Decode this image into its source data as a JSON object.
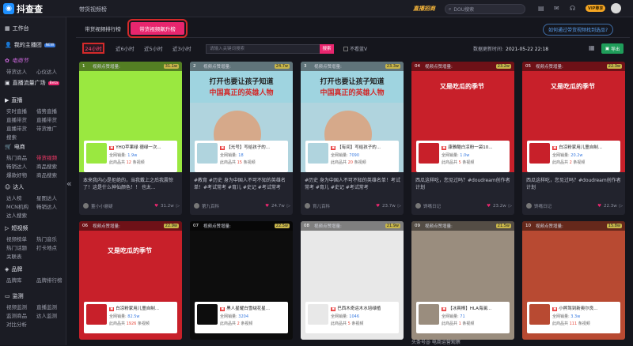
{
  "topbar": {
    "logo_text": "抖查查",
    "page_title": "带货视频榜",
    "promo": "直播招商",
    "search_placeholder": "DOU搜索",
    "vip": "VIP尊享",
    "icons": [
      "printer-icon",
      "mail-icon",
      "headset-icon"
    ]
  },
  "sidebar": {
    "workbench": "工作台",
    "my_host": "我的主播团",
    "my_host_badge": "NEW",
    "festival": "电商节",
    "festival_sub": [
      "带货达人",
      "心仪达人"
    ],
    "traffic": "直播流量广场",
    "traffic_badge": "Beta",
    "live": "直播",
    "live_sub": [
      "实时直播",
      "借势直播",
      "直播带货",
      "直播带货",
      "直播带货",
      "带货推广",
      "搜索"
    ],
    "ecom": "电商",
    "ecom_sub": [
      "热门商品",
      "带货视频",
      "畅销达人",
      "商品搜索",
      "爆款好物",
      "商品搜索"
    ],
    "talent": "达人",
    "talent_sub": [
      "达人榜",
      "星图达人",
      "MCN机构",
      "畅销达人",
      "达人搜索"
    ],
    "short_video": "短视频",
    "short_video_sub": [
      "视频榜单",
      "热门音乐",
      "热门话题",
      "打卡地点",
      "关联表"
    ],
    "brand": "品牌",
    "brand_sub": [
      "品牌库",
      "品牌排行榜"
    ],
    "monitor": "监测",
    "monitor_sub": [
      "视频监测",
      "直播监测",
      "监测商品",
      "达人监测",
      "对比分析"
    ]
  },
  "tabs": {
    "tab1": "带货视频排行榜",
    "tab2": "带货视频飙升榜",
    "help": "如何通过带货视频找到选品?"
  },
  "filters": {
    "ranges": [
      "24小时",
      "近6小时",
      "近5小时",
      "近3小时"
    ],
    "keyword_placeholder": "请输入关键词搜索",
    "search_btn": "搜索",
    "exclude_v": "不看蓝V",
    "update_label": "数据更新时间:",
    "update_time": "2021-05-22 22:18",
    "refresh": "数据更新",
    "export": "导出"
  },
  "card_header_label": "视频点赞增量:",
  "prod_sales_label": "全网销量:",
  "prod_fav_label": "此商品共",
  "prod_fav_suffix": "条视频",
  "cards": [
    {
      "rank": "1",
      "inc": "31.1w",
      "title": "YHQ苹果绿 德绿一次...",
      "sales": "1.9w",
      "fav": "12",
      "desc": "本来我内心是拒绝的，当我戴上之后我震惊了！这是什么神仙颜色！！ 也太...",
      "author": "董小小悬疑",
      "likes": "31.2w",
      "bg": "#9ae840"
    },
    {
      "rank": "2",
      "inc": "24.7w",
      "title": "【光号】写给孩子的...",
      "sales": "18",
      "fav": "15",
      "desc": "#教育 #历史 身为中国人不可不知的英雄名单！#考试常考 #育儿 #史记 #考试常考",
      "author": "第九百科",
      "likes": "24.7w",
      "bg": "#b0d4de"
    },
    {
      "rank": "3",
      "inc": "23.3w",
      "title": "【有间】写给孩子的...",
      "sales": "7090",
      "fav": "20",
      "desc": "#历史 身为中国人不可不知的英雄名单！考试常考 #育儿 #史记 #考试常考",
      "author": "育儿百科",
      "likes": "23.7w",
      "bg": "#b0d4de"
    },
    {
      "rank": "04",
      "inc": "23.2w",
      "title": "康雅酷白凉粉一袋10...",
      "sales": "1.0w",
      "fav": "5",
      "desc": "西瓜这样吃，您见过吗？#doudream创作者计划",
      "author": "馋嘴日记",
      "likes": "23.2w",
      "bg": "#c8202a"
    },
    {
      "rank": "05",
      "inc": "22.3w",
      "title": "白凉粉家用儿童自制...",
      "sales": "20.2w",
      "fav": "2",
      "desc": "西瓜这样吃，您见过吗？#doudream创作者计划",
      "author": "馋嘴日记",
      "likes": "22.3w",
      "bg": "#c8202a"
    },
    {
      "rank": "06",
      "inc": "22.9w",
      "title": "白凉粉家用儿童自制...",
      "sales": "82.5w",
      "fav": "1926",
      "desc": "",
      "author": "",
      "likes": "",
      "bg": "#c8202a"
    },
    {
      "rank": "07",
      "inc": "22.5w",
      "title": "黑人星耀白雪绒花星...",
      "sales": "3204",
      "fav": "2",
      "desc": "",
      "author": "",
      "likes": "",
      "bg": "#0d0d0d"
    },
    {
      "rank": "08",
      "inc": "21.9w",
      "title": "巴西木奇运木水培绿植",
      "sales": "1046",
      "fav": "5",
      "desc": "",
      "author": "",
      "likes": "",
      "bg": "#e8e8e8"
    },
    {
      "rank": "09",
      "inc": "21.5w",
      "title": "【冰爽棒】HLA海澜...",
      "sales": "71",
      "fav": "1",
      "desc": "",
      "author": "",
      "likes": "",
      "bg": "#9a8d7e"
    },
    {
      "rank": "10",
      "inc": "15.8w",
      "title": "小熊驾到新奥尔良...",
      "sales": "3.3w",
      "fav": "111",
      "desc": "",
      "author": "",
      "likes": "",
      "bg": "#b84a32"
    }
  ],
  "overlay": {
    "line1": "打开也要让孩子知道",
    "line2": "中国真正的英雄人物",
    "watermelon": "又是吃瓜的季节"
  },
  "watermark": "头条号@ 电商运营观察"
}
